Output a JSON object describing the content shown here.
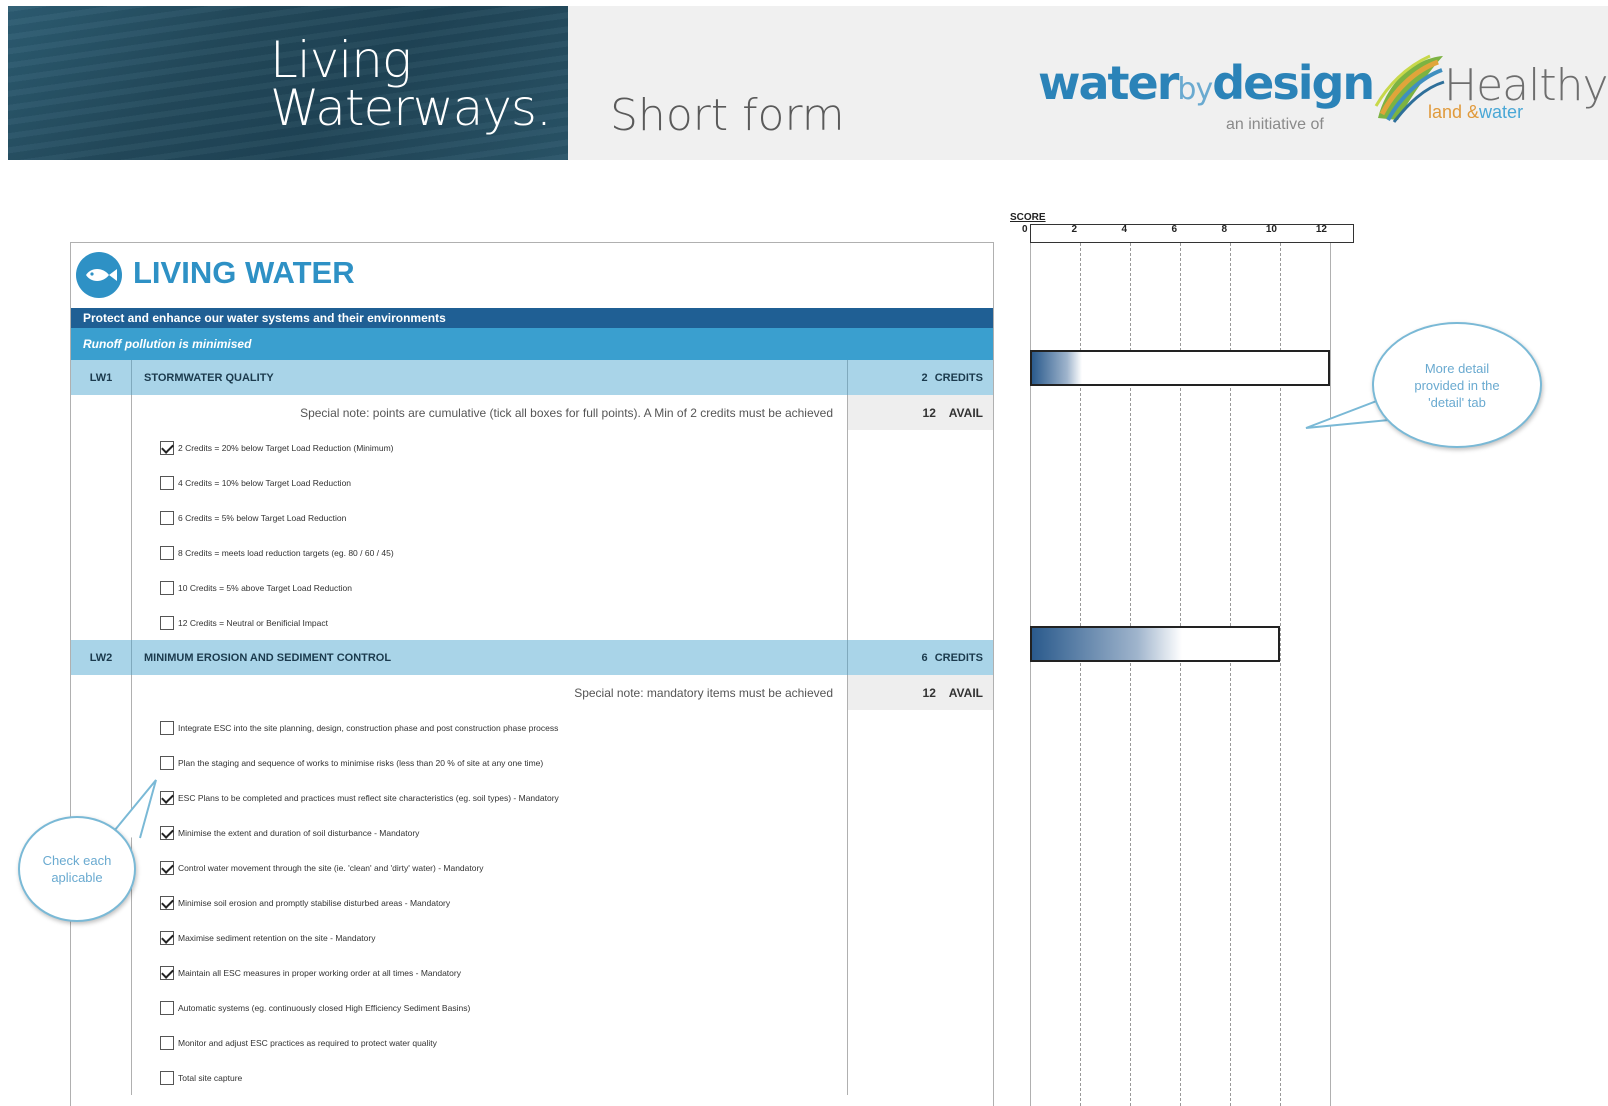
{
  "header": {
    "logo_line1": "Living",
    "logo_line2": "Waterways.",
    "form_type": "Short form",
    "partner_water": "water",
    "partner_by": "by",
    "partner_design": "design",
    "partner_tagline": "an initiative of",
    "partner2_name": "Healthy",
    "partner2_land": "land &",
    "partner2_water": "water"
  },
  "form": {
    "title": "LIVING WATER",
    "banner": "Protect and enhance our water systems and their environments",
    "subbanner": "Runoff pollution is minimised",
    "sections": [
      {
        "code": "LW1",
        "title": "STORMWATER QUALITY",
        "credits": "2 CREDITS",
        "note": "Special note: points are cumulative (tick all boxes for full points). A Min of 2 credits must be achieved",
        "available": "12 AVAIL",
        "options": [
          {
            "label": "2 Credits = 20% below Target Load Reduction (Minimum)",
            "checked": true
          },
          {
            "label": "4 Credits = 10% below Target Load Reduction",
            "checked": false
          },
          {
            "label": "6 Credits = 5% below Target Load Reduction",
            "checked": false
          },
          {
            "label": "8 Credits = meets load reduction targets (eg. 80 / 60 / 45)",
            "checked": false
          },
          {
            "label": "10 Credits = 5% above Target Load Reduction",
            "checked": false
          },
          {
            "label": "12 Credits = Neutral or Benificial Impact",
            "checked": false
          }
        ]
      },
      {
        "code": "LW2",
        "title": "MINIMUM EROSION AND SEDIMENT CONTROL",
        "credits": "6 CREDITS",
        "note": "Special note: mandatory items must be achieved",
        "available": "12 AVAIL",
        "options": [
          {
            "label": "Integrate ESC into the site planning, design, construction phase and post construction phase process",
            "checked": false
          },
          {
            "label": "Plan the staging and sequence of works to minimise risks (less than 20 % of site at any one time)",
            "checked": false
          },
          {
            "label": "ESC Plans to be completed and practices must reflect site characteristics (eg. soil types) - Mandatory",
            "checked": true
          },
          {
            "label": "Minimise the extent and duration of soil disturbance - Mandatory",
            "checked": true
          },
          {
            "label": "Control water movement through the site (ie. 'clean' and 'dirty' water) - Mandatory",
            "checked": true
          },
          {
            "label": "Minimise soil erosion and promptly stabilise disturbed areas - Mandatory",
            "checked": true
          },
          {
            "label": "Maximise sediment retention on the site - Mandatory",
            "checked": true
          },
          {
            "label": "Maintain all ESC measures in proper working order at all times - Mandatory",
            "checked": true
          },
          {
            "label": "Automatic systems (eg. continuously closed High Efficiency Sediment Basins)",
            "checked": false
          },
          {
            "label": "Monitor and adjust ESC practices as required to protect water quality",
            "checked": false
          },
          {
            "label": "Total site capture",
            "checked": false
          }
        ]
      }
    ]
  },
  "chart_data": {
    "type": "bar",
    "title": "SCORE",
    "orientation": "horizontal",
    "x_ticks": [
      "0",
      "2",
      "4",
      "6",
      "8",
      "10",
      "12"
    ],
    "xlim": [
      0,
      12
    ],
    "categories": [
      "LW1",
      "LW2"
    ],
    "series": [
      {
        "values": [
          2,
          6
        ]
      }
    ],
    "available": [
      12,
      10
    ],
    "fill_color_start": "#2a5a8c",
    "fill_color_end": "#ffffff"
  },
  "callouts": {
    "detail": "More detail provided in the 'detail' tab",
    "check": "Check each aplicable"
  },
  "colors": {
    "brand_blue": "#2e91c5",
    "banner_dark": "#1f5f94",
    "banner_mid": "#3a9fcf",
    "section_head": "#a9d4e8"
  }
}
